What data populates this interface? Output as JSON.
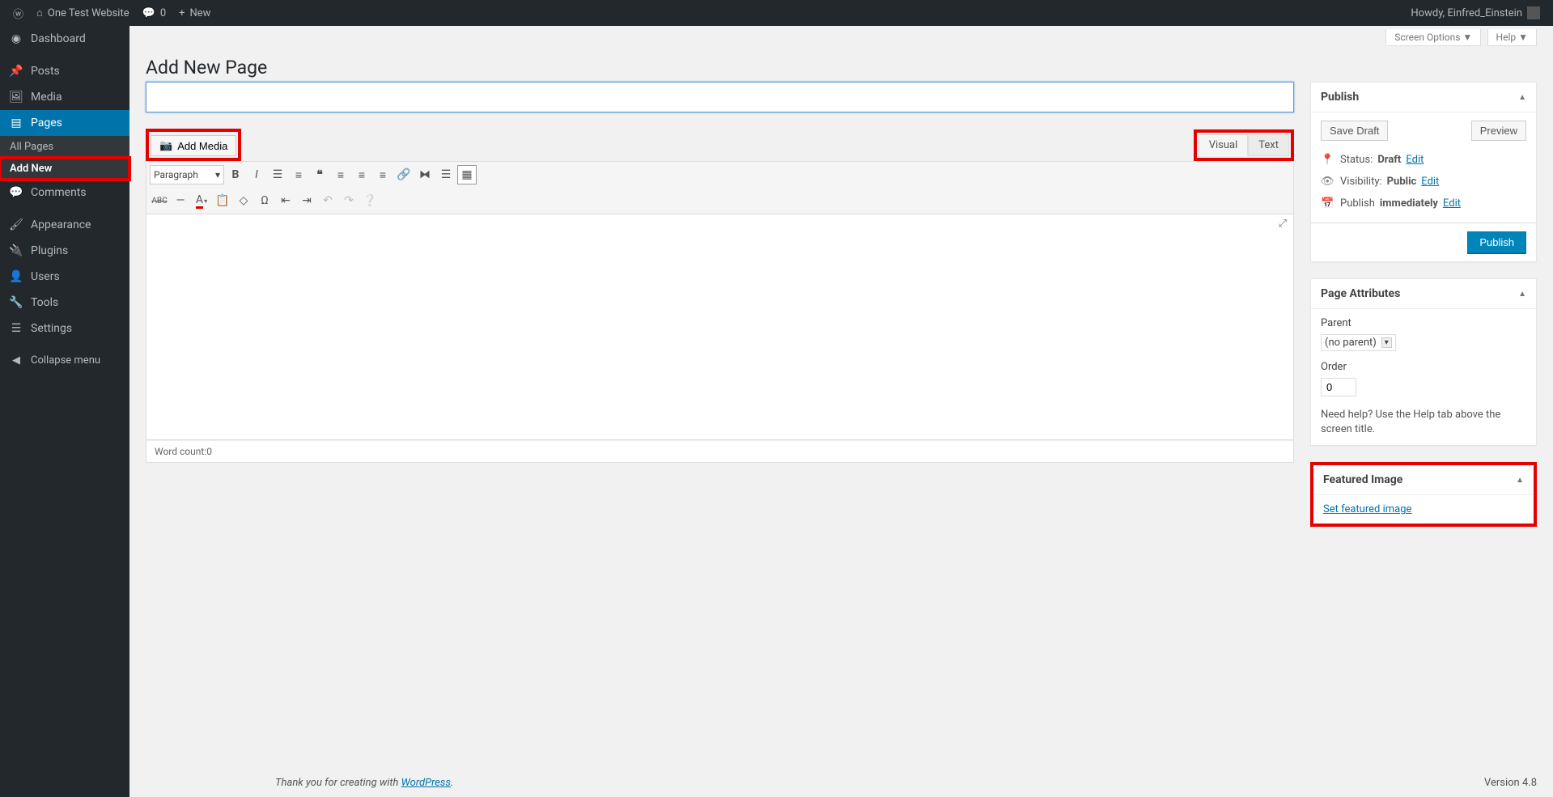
{
  "adminbar": {
    "site_name": "One Test Website",
    "comments_count": "0",
    "new_label": "New",
    "howdy": "Howdy, Einfred_Einstein"
  },
  "sidebar": {
    "dashboard": "Dashboard",
    "posts": "Posts",
    "media": "Media",
    "pages": "Pages",
    "pages_sub_all": "All Pages",
    "pages_sub_add": "Add New",
    "comments": "Comments",
    "appearance": "Appearance",
    "plugins": "Plugins",
    "users": "Users",
    "tools": "Tools",
    "settings": "Settings",
    "collapse": "Collapse menu"
  },
  "screen_meta": {
    "screen_options": "Screen Options",
    "help": "Help"
  },
  "page": {
    "title": "Add New Page",
    "title_input_value": ""
  },
  "editor": {
    "add_media": "Add Media",
    "tab_visual": "Visual",
    "tab_text": "Text",
    "format_select": "Paragraph",
    "word_count_label": "Word count: ",
    "word_count": "0"
  },
  "publish_box": {
    "heading": "Publish",
    "save_draft": "Save Draft",
    "preview": "Preview",
    "status_label": "Status:",
    "status_value": "Draft",
    "status_edit": "Edit",
    "visibility_label": "Visibility:",
    "visibility_value": "Public",
    "visibility_edit": "Edit",
    "publish_label": "Publish",
    "publish_value": "immediately",
    "publish_edit": "Edit",
    "publish_btn": "Publish"
  },
  "page_attr_box": {
    "heading": "Page Attributes",
    "parent_label": "Parent",
    "parent_value": "(no parent)",
    "order_label": "Order",
    "order_value": "0",
    "help_text": "Need help? Use the Help tab above the screen title."
  },
  "featured_box": {
    "heading": "Featured Image",
    "link": "Set featured image"
  },
  "footer": {
    "thank_you": "Thank you for creating with ",
    "wp_link": "WordPress",
    "period": ".",
    "version": "Version 4.8"
  }
}
